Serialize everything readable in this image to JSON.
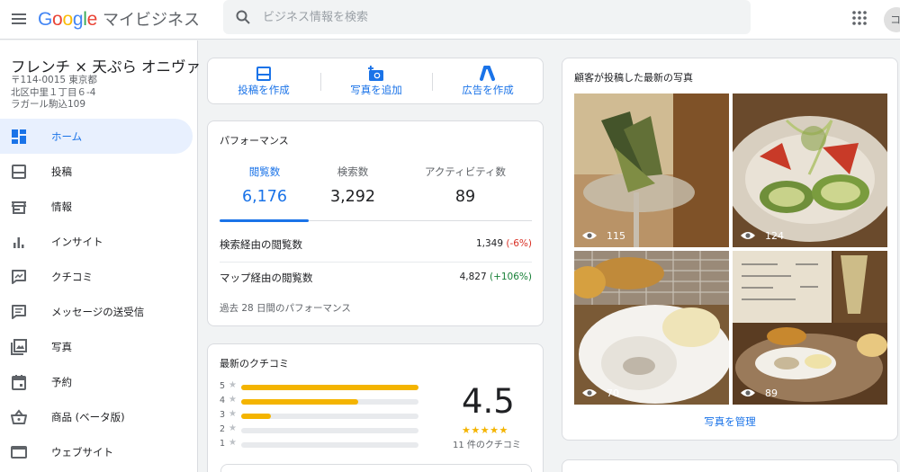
{
  "header": {
    "brand_google": "Google",
    "brand_product": "マイビジネス",
    "search_placeholder": "ビジネス情報を検索",
    "avatar_initial": "コ"
  },
  "business": {
    "name": "フレンチ × 天ぷら オニヴァ",
    "address_lines": [
      "〒114-0015 東京都",
      "北区中里１丁目６-4",
      "ラガール駒込109"
    ]
  },
  "sidebar": {
    "items": [
      {
        "label": "ホーム",
        "icon": "dashboard-icon",
        "active": true
      },
      {
        "label": "投稿",
        "icon": "posts-icon"
      },
      {
        "label": "情報",
        "icon": "store-icon"
      },
      {
        "label": "インサイト",
        "icon": "insights-icon"
      },
      {
        "label": "クチコミ",
        "icon": "reviews-icon"
      },
      {
        "label": "メッセージの送受信",
        "icon": "messages-icon"
      },
      {
        "label": "写真",
        "icon": "photos-icon"
      },
      {
        "label": "予約",
        "icon": "calendar-icon"
      },
      {
        "label": "商品 (ベータ版)",
        "icon": "basket-icon"
      },
      {
        "label": "ウェブサイト",
        "icon": "website-icon"
      }
    ]
  },
  "actions": {
    "create_post": "投稿を作成",
    "add_photo": "写真を追加",
    "create_ad": "広告を作成"
  },
  "performance": {
    "title": "パフォーマンス",
    "metrics": [
      {
        "label": "閲覧数",
        "value": "6,176",
        "active": true
      },
      {
        "label": "検索数",
        "value": "3,292"
      },
      {
        "label": "アクティビティ数",
        "value": "89"
      }
    ],
    "search_views": {
      "label": "検索経由の閲覧数",
      "value": "1,349",
      "change": "(-6%)"
    },
    "map_views": {
      "label": "マップ経由の閲覧数",
      "value": "4,827",
      "change": "(+106%)"
    },
    "footer": "過去 28 日間のパフォーマンス"
  },
  "reviews": {
    "title": "最新のクチコミ",
    "distribution": [
      {
        "stars": "5",
        "fraction": 1.0
      },
      {
        "stars": "4",
        "fraction": 0.66
      },
      {
        "stars": "3",
        "fraction": 0.17
      },
      {
        "stars": "2",
        "fraction": 0.0
      },
      {
        "stars": "1",
        "fraction": 0.0
      }
    ],
    "star_glyph": "★",
    "rating": "4.5",
    "rating_stars": "★★★★★",
    "count": "11 件のクチコミ"
  },
  "photos": {
    "title": "顧客が投稿した最新の写真",
    "items": [
      {
        "views": "115"
      },
      {
        "views": "124"
      },
      {
        "views": "70"
      },
      {
        "views": "89"
      }
    ],
    "manage_label": "写真を管理"
  },
  "colors": {
    "accent": "#1a73e8",
    "star": "#f4b400",
    "negative": "#d93025",
    "positive": "#188038"
  }
}
